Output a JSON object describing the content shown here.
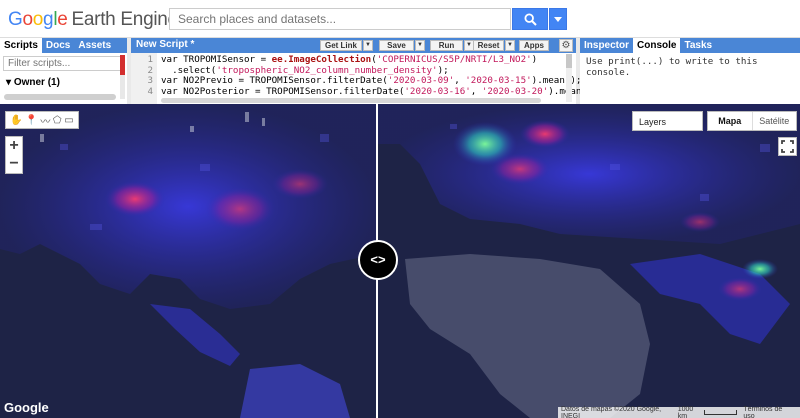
{
  "header": {
    "logo_google": "Google",
    "logo_product": "Earth Engine",
    "search_placeholder": "Search places and datasets..."
  },
  "left_panel": {
    "tabs": [
      {
        "label": "Scripts",
        "active": true
      },
      {
        "label": "Docs",
        "active": false
      },
      {
        "label": "Assets",
        "active": false
      }
    ],
    "filter_placeholder": "Filter scripts...",
    "owner_label": "Owner",
    "owner_count": "(1)"
  },
  "editor": {
    "title": "New Script *",
    "buttons": {
      "get_link": "Get Link",
      "save": "Save",
      "run": "Run",
      "reset": "Reset",
      "apps": "Apps"
    },
    "line_numbers": [
      "1",
      "2",
      "3",
      "4"
    ]
  },
  "right_panel": {
    "tabs": [
      {
        "label": "Inspector",
        "active": false
      },
      {
        "label": "Console",
        "active": true
      },
      {
        "label": "Tasks",
        "active": false
      }
    ],
    "console_message": "Use print(...) to write to this console."
  },
  "map": {
    "layers_label": "Layers",
    "map_types": [
      {
        "label": "Mapa",
        "selected": true
      },
      {
        "label": "Satélite",
        "selected": false
      }
    ],
    "zoom_in": "+",
    "zoom_out": "−",
    "swipe_glyph": "<>",
    "google_logo": "Google",
    "attribution": {
      "data": "Datos de mapas ©2020 Google, INEGI",
      "scale": "1000 km",
      "terms": "Términos de uso"
    }
  },
  "colors": {
    "accent_blue": "#4285f4",
    "tab_bar_blue": "#4a86d6",
    "map_base": "#1d2244"
  }
}
